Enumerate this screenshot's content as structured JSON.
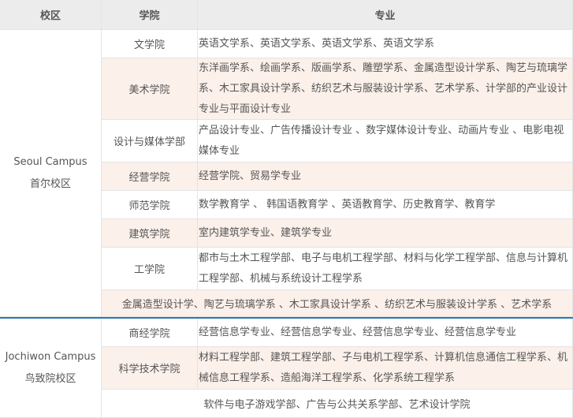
{
  "headers": {
    "campus": "校区",
    "college": "学院",
    "major": "专业"
  },
  "seoul": {
    "campus_en": "Seoul Campus",
    "campus_cn": "首尔校区",
    "rows": [
      {
        "college": "文学院",
        "majors": "英语文学系、英语文学系、英语文学系、英语文学系"
      },
      {
        "college": "美术学院",
        "majors": "东洋画学系、绘画学系、版画学系、雕塑学系、金属造型设计学系、陶艺与琉璃学系、木工家具设计学系、纺织艺术与服装设计学系、艺术学系、计学部的产业设计专业与平面设计专业"
      },
      {
        "college": "设计与媒体学部",
        "majors": "产品设计专业、广告传播设计专业 、数字媒体设计专业、动画片专业 、电影电视媒体专业"
      },
      {
        "college": "经营学院",
        "majors": "经营学院、贸易学专业"
      },
      {
        "college": "师范学院",
        "majors": "数学教育学 、 韩国语教育学 、英语教育学、历史教育学、教育学"
      },
      {
        "college": "建筑学院",
        "majors": "室内建筑学专业、建筑学专业"
      },
      {
        "college": "工学院",
        "majors": "都市与土木工程学部、电子与电机工程学部、材料与化学工程学部、信息与计算机工程学部、机械与系统设计工程学系"
      }
    ],
    "span_row": "金属造型设计学、陶艺与琉璃学系 、木工家具设计学系 、纺织艺术与服装设计学系 、艺术学系"
  },
  "jochiwon": {
    "campus_en": "Jochiwon Campus",
    "campus_cn": "鸟致院校区",
    "rows": [
      {
        "college": "商经学院",
        "majors": "经营信息学专业、经营信息学专业、经营信息学专业、经营信息学专业"
      },
      {
        "college": "科学技术学院",
        "majors": "材料工程学部、建筑工程学部、子与电机工程学系、计算机信息通信工程学系、机械信息工程学系、造船海洋工程学系、化学系统工程学系"
      }
    ],
    "span_row": "软件与电子游戏学部、广告与公共关系学部、艺术设计学院"
  }
}
